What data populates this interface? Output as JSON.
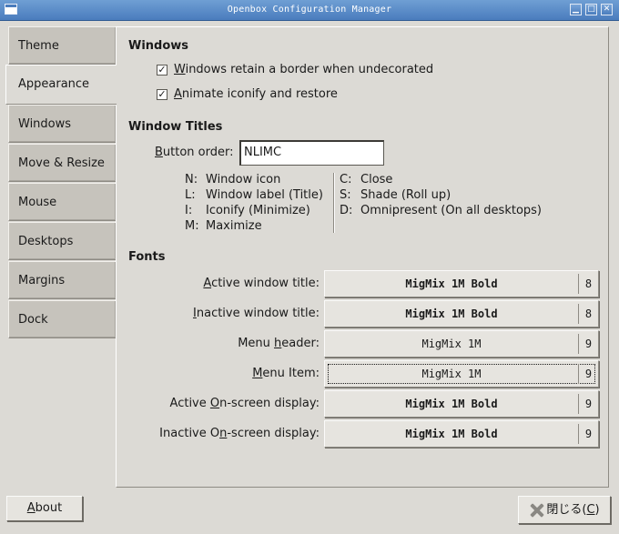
{
  "window": {
    "title": "Openbox Configuration Manager",
    "min_glyph": "▁",
    "max_glyph": "□",
    "close_glyph": "✕"
  },
  "tabs": [
    {
      "label": "Theme",
      "active": false
    },
    {
      "label": "Appearance",
      "active": true
    },
    {
      "label": "Windows",
      "active": false
    },
    {
      "label": "Move & Resize",
      "active": false
    },
    {
      "label": "Mouse",
      "active": false
    },
    {
      "label": "Desktops",
      "active": false
    },
    {
      "label": "Margins",
      "active": false
    },
    {
      "label": "Dock",
      "active": false
    }
  ],
  "windows": {
    "title": "Windows",
    "border_first": "W",
    "border_rest": "indows retain a border when undecorated",
    "border_checked": true,
    "animate_first": "A",
    "animate_rest": "nimate iconify and restore",
    "animate_checked": true
  },
  "titles": {
    "title": "Window Titles",
    "button_order_first": "B",
    "button_order_rest": "utton order:",
    "button_order_value": "NLIMC",
    "legend_left": [
      {
        "key": "N:",
        "desc": "Window icon"
      },
      {
        "key": "L:",
        "desc": "Window label (Title)"
      },
      {
        "key": "I:",
        "desc": "Iconify (Minimize)"
      },
      {
        "key": "M:",
        "desc": "Maximize"
      }
    ],
    "legend_right": [
      {
        "key": "C:",
        "desc": "Close"
      },
      {
        "key": "S:",
        "desc": "Shade (Roll up)"
      },
      {
        "key": "D:",
        "desc": "Omnipresent (On all desktops)"
      }
    ]
  },
  "fonts": {
    "title": "Fonts",
    "rows": [
      {
        "pre": "",
        "u": "A",
        "post": "ctive window title:",
        "font": "MigMix 1M Bold",
        "size": "8",
        "bold": true
      },
      {
        "pre": "",
        "u": "I",
        "post": "nactive window title:",
        "font": "MigMix 1M Bold",
        "size": "8",
        "bold": true
      },
      {
        "pre": "Menu ",
        "u": "h",
        "post": "eader:",
        "font": "MigMix 1M",
        "size": "9",
        "bold": false
      },
      {
        "pre": "",
        "u": "M",
        "post": "enu Item:",
        "font": "MigMix 1M",
        "size": "9",
        "bold": false
      },
      {
        "pre": "Active ",
        "u": "O",
        "post": "n-screen display:",
        "font": "MigMix 1M Bold",
        "size": "9",
        "bold": true
      },
      {
        "pre": "Inactive O",
        "u": "n",
        "post": "-screen display:",
        "font": "MigMix 1M Bold",
        "size": "9",
        "bold": true
      }
    ]
  },
  "footer": {
    "about_first": "A",
    "about_rest": "bout",
    "close_label": "閉じる(",
    "close_mnemonic": "C",
    "close_suffix": ")"
  }
}
